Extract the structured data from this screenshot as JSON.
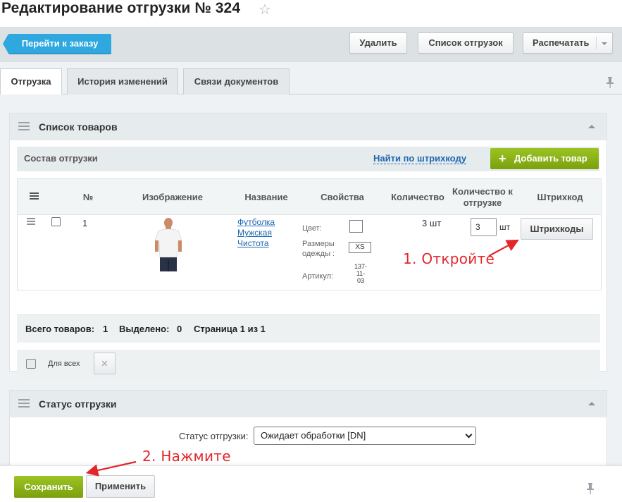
{
  "header": {
    "title": "Редактирование отгрузки № 324"
  },
  "toolbar": {
    "back_label": "Перейти к заказу",
    "delete_label": "Удалить",
    "list_label": "Список отгрузок",
    "print_label": "Распечатать"
  },
  "tabs": [
    {
      "label": "Отгрузка",
      "active": true
    },
    {
      "label": "История изменений",
      "active": false
    },
    {
      "label": "Связи документов",
      "active": false
    }
  ],
  "products_section": {
    "title": "Список товаров",
    "subhead_title": "Состав отгрузки",
    "find_barcode_label": "Найти по штрихкоду",
    "add_product_label": "Добавить товар",
    "columns": [
      "№",
      "Изображение",
      "Название",
      "Свойства",
      "Количество",
      "Количество к отгрузке",
      "Штрихкод"
    ],
    "rows": [
      {
        "number": "1",
        "name_lines": [
          "Футболка",
          "Мужская",
          "Чистота"
        ],
        "props": {
          "color_label": "Цвет:",
          "size_label": "Размеры одежды :",
          "size_value": "XS",
          "article_label": "Артикул:",
          "article_value_lines": [
            "137-",
            "11-",
            "03"
          ]
        },
        "quantity": "3 шт",
        "ship_quantity": "3",
        "ship_unit": "шт",
        "barcode_button": "Штрихкоды"
      }
    ],
    "footer": {
      "total_label": "Всего товаров:",
      "total_value": "1",
      "selected_label": "Выделено:",
      "selected_value": "0",
      "page_text": "Страница 1 из 1"
    },
    "for_all_label": "Для всех",
    "delete_icon": "×"
  },
  "status_section": {
    "title": "Статус отгрузки",
    "field_label": "Статус отгрузки:",
    "selected_value": "Ожидает обработки [DN]"
  },
  "bottom": {
    "save_label": "Сохранить",
    "apply_label": "Применить"
  },
  "annotations": {
    "step1": "1. Откройте",
    "step2": "2. Нажмите"
  },
  "colors": {
    "accent_blue": "#2fa7df",
    "accent_green": "#8bb31a",
    "annotation_red": "#e3262b",
    "link_blue": "#2067b0"
  },
  "icons": [
    "star-icon",
    "pin-icon",
    "menu-icon",
    "collapse-icon",
    "plus-icon",
    "shirt-image",
    "close-icon"
  ]
}
